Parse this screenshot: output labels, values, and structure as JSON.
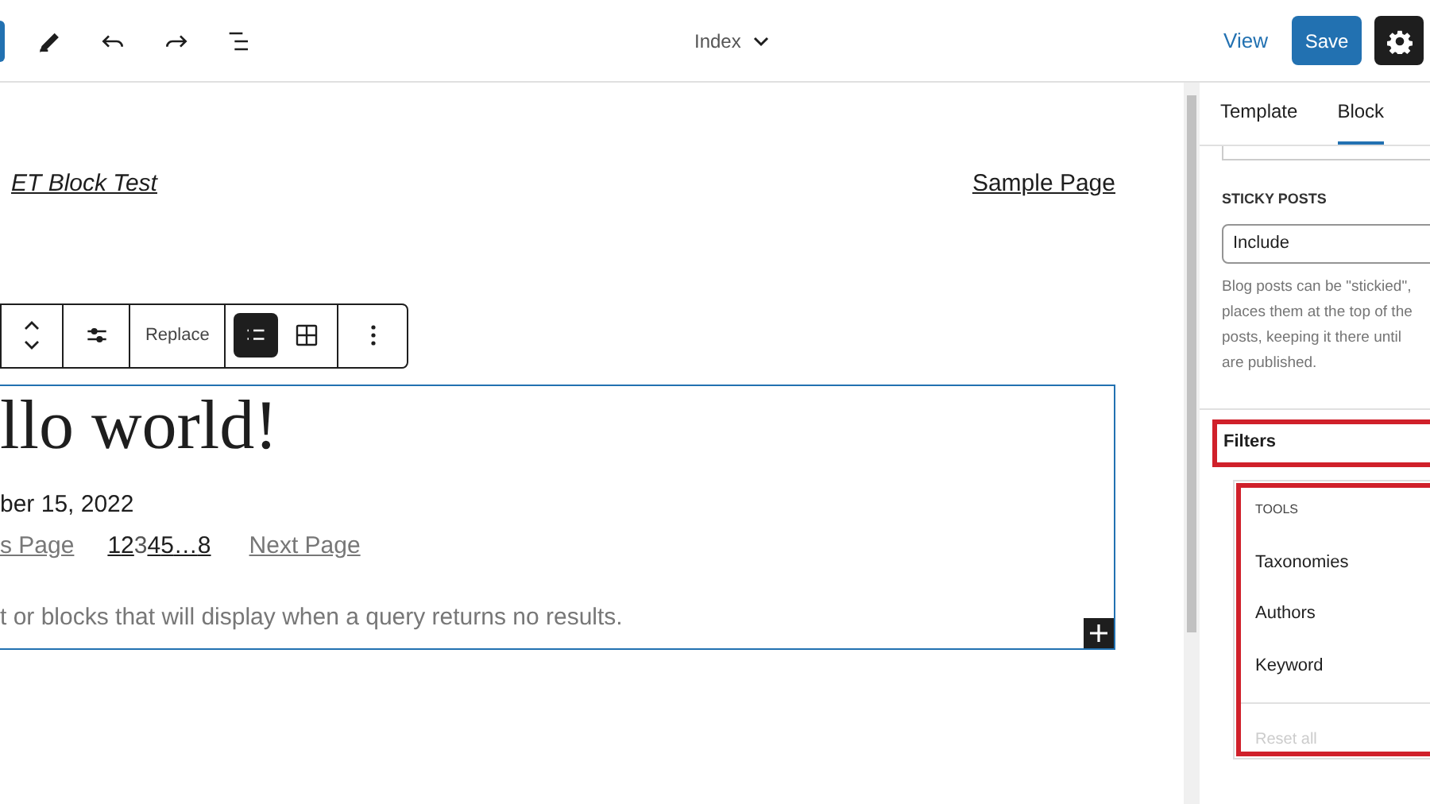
{
  "top_bar": {
    "template_title": "Index",
    "view_link": "View",
    "save_button": "Save"
  },
  "site_header": {
    "site_title": "ET Block Test",
    "nav_link": "Sample Page"
  },
  "block_toolbar": {
    "replace_button": "Replace",
    "layouts": [
      {
        "kind": "list",
        "selected": true
      },
      {
        "kind": "grid",
        "selected": false
      }
    ]
  },
  "query_block": {
    "post_title": "llo world!",
    "post_date": "ber 15, 2022",
    "previous_link": "s Page",
    "pages": [
      {
        "label": "1",
        "selected": false
      },
      {
        "label": "2",
        "selected": false
      },
      {
        "label": "3",
        "selected": true
      },
      {
        "label": "4",
        "selected": false
      },
      {
        "label": "5",
        "selected": false
      },
      {
        "label": "…",
        "selected": false
      },
      {
        "label": "8",
        "selected": false
      }
    ],
    "next_link": "Next Page",
    "no_results_text": "t or blocks that will display when a query returns no results."
  },
  "sidebar": {
    "tabs": [
      {
        "label": "Template",
        "selected": false
      },
      {
        "label": "Block",
        "selected": true
      }
    ],
    "sticky_posts": {
      "label": "STICKY POSTS",
      "value": "Include",
      "help_lines": [
        "Blog posts can be \"stickied\",",
        "places them at the top of the",
        "posts, keeping it there until",
        "are published."
      ]
    },
    "filters": {
      "title": "Filters",
      "menu_heading": "TOOLS",
      "items": [
        "Taxonomies",
        "Authors",
        "Keyword"
      ],
      "reset": "Reset all"
    }
  }
}
